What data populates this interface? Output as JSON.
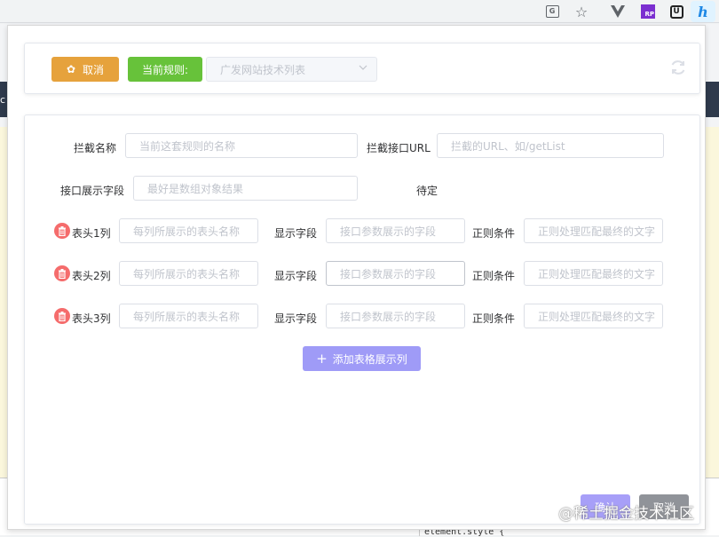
{
  "browser": {
    "extensions": [
      "translate-icon",
      "star-icon",
      "vue-devtools-icon",
      "rp-icon",
      "ublock-icon",
      "extension-h-icon"
    ],
    "rp_label": "RP",
    "u_label": "U",
    "h_label": "h",
    "translate_label": "G"
  },
  "background": {
    "c_letter": "c",
    "devtools_text": "element.style {"
  },
  "toolbar": {
    "cancel_label": "取消",
    "current_rule_label": "当前规则:",
    "rule_select_placeholder": "广发网站技术列表"
  },
  "form": {
    "intercept_name_label": "拦截名称",
    "intercept_name_placeholder": "当前这套规则的名称",
    "intercept_url_label": "拦截接口URL",
    "intercept_url_placeholder": "拦截的URL、如/getList",
    "display_field_label": "接口展示字段",
    "display_field_placeholder": "最好是数组对象结果",
    "pending_label": "待定",
    "columns": [
      {
        "header_label": "表头1列",
        "header_placeholder": "每列所展示的表头名称",
        "field_label": "显示字段",
        "field_placeholder": "接口参数展示的字段",
        "regex_label": "正则条件",
        "regex_placeholder": "正则处理匹配最终的文字"
      },
      {
        "header_label": "表头2列",
        "header_placeholder": "每列所展示的表头名称",
        "field_label": "显示字段",
        "field_placeholder": "接口参数展示的字段",
        "regex_label": "正则条件",
        "regex_placeholder": "正则处理匹配最终的文字"
      },
      {
        "header_label": "表头3列",
        "header_placeholder": "每列所展示的表头名称",
        "field_label": "显示字段",
        "field_placeholder": "接口参数展示的字段",
        "regex_label": "正则条件",
        "regex_placeholder": "正则处理匹配最终的文字"
      }
    ],
    "add_column_label": "添加表格展示列"
  },
  "footer": {
    "confirm_label": "确认",
    "cancel_label": "取消"
  },
  "watermark": "@稀土掘金技术社区",
  "colors": {
    "warning": "#e6a23c",
    "success": "#67c23a",
    "primary_light": "#9f9bf7",
    "danger": "#f56c6c",
    "info": "#909399"
  }
}
